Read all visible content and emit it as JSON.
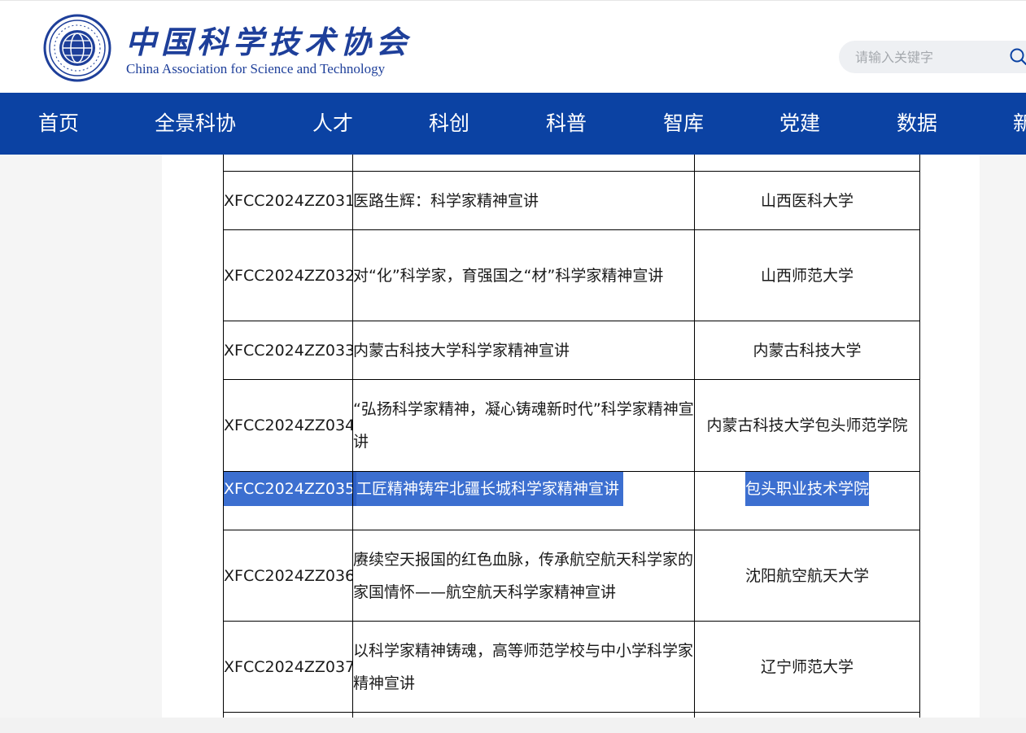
{
  "header": {
    "logo_cn": "中国科学技术协会",
    "logo_en": "China Association for Science and Technology",
    "search_placeholder": "请输入关键字"
  },
  "nav": {
    "items": [
      "首页",
      "全景科协",
      "人才",
      "科创",
      "科普",
      "智库",
      "党建",
      "数据",
      "新"
    ]
  },
  "table": {
    "rows": [
      {
        "code": "XFCC2024ZZ031",
        "title": "医路生辉：科学家精神宣讲",
        "org": "山西医科大学",
        "height": 72
      },
      {
        "code": "XFCC2024ZZ032",
        "title": "对“化”科学家，育强国之“材”科学家精神宣讲",
        "org": "山西师范大学",
        "height": 112
      },
      {
        "code": "XFCC2024ZZ033",
        "title": "内蒙古科技大学科学家精神宣讲",
        "org": "内蒙古科技大学",
        "height": 72
      },
      {
        "code": "XFCC2024ZZ034",
        "title": "“弘扬科学家精神，凝心铸魂新时代”科学家精神宣讲",
        "org": "内蒙古科技大学包头师范学院",
        "height": 113
      },
      {
        "code": "XFCC2024ZZ035",
        "title": "工匠精神铸牢北疆长城科学家精神宣讲",
        "org": "包头职业技术学院",
        "height": 72,
        "selected": true
      },
      {
        "code": "XFCC2024ZZ036",
        "title": "赓续空天报国的红色血脉，传承航空航天科学家的家国情怀——航空航天科学家精神宣讲",
        "org": "沈阳航空航天大学",
        "height": 112
      },
      {
        "code": "XFCC2024ZZ037",
        "title": "以科学家精神铸魂，高等师范学校与中小学科学家精神宣讲",
        "org": "辽宁师范大学",
        "height": 112
      }
    ]
  },
  "colors": {
    "nav_bg": "#0b42a3",
    "logo_blue": "#1e3f9a",
    "selection": "#3c6fd0"
  }
}
